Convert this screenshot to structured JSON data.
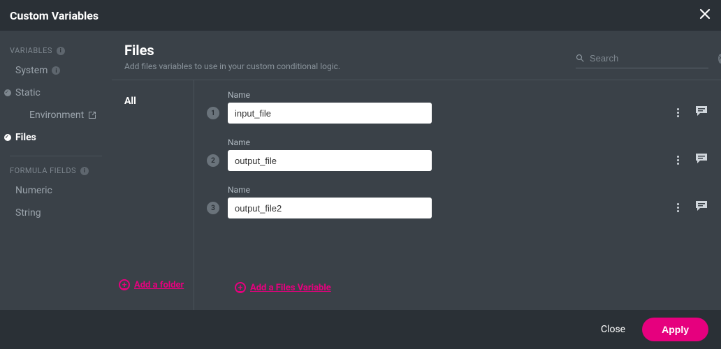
{
  "header": {
    "title": "Custom Variables"
  },
  "sidebar": {
    "groups": {
      "variables": {
        "label": "VARIABLES",
        "items": [
          {
            "label": "System"
          },
          {
            "label": "Static"
          },
          {
            "label": "Environment"
          },
          {
            "label": "Files"
          }
        ]
      },
      "formula": {
        "label": "FORMULA FIELDS",
        "items": [
          {
            "label": "Numeric"
          },
          {
            "label": "String"
          }
        ]
      }
    }
  },
  "main": {
    "title": "Files",
    "subtitle": "Add files variables to use in your custom conditional logic.",
    "search": {
      "placeholder": "Search",
      "value": ""
    },
    "folders": {
      "selected": "All"
    },
    "field_label": "Name",
    "variables": [
      {
        "num": "1",
        "name": "input_file"
      },
      {
        "num": "2",
        "name": "output_file"
      },
      {
        "num": "3",
        "name": "output_file2"
      }
    ],
    "add_folder_label": "Add a folder",
    "add_variable_label": "Add a Files Variable"
  },
  "footer": {
    "close_label": "Close",
    "apply_label": "Apply"
  },
  "colors": {
    "accent": "#e6007e"
  }
}
